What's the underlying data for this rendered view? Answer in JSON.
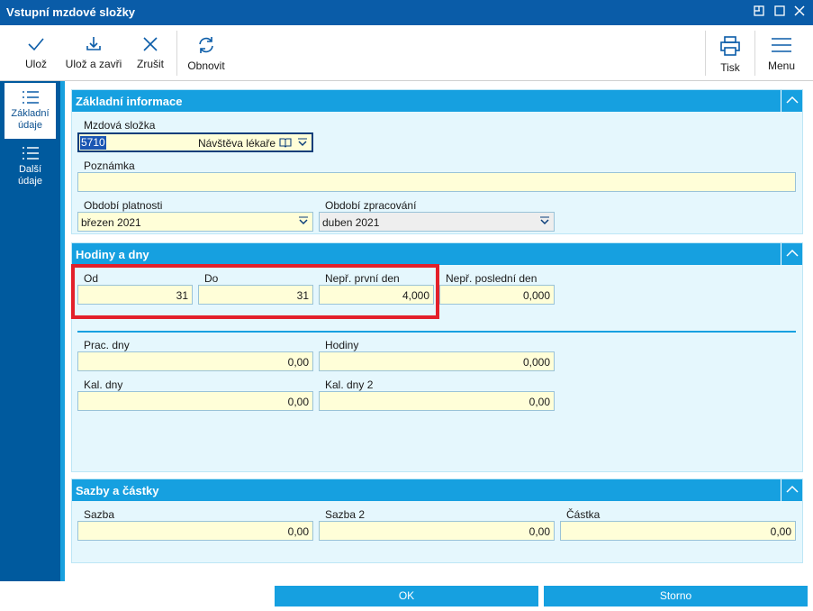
{
  "window": {
    "title": "Vstupní mzdové složky"
  },
  "toolbar": {
    "save": "Ulož",
    "save_close": "Ulož a zavři",
    "cancel": "Zrušit",
    "refresh": "Obnovit",
    "print": "Tisk",
    "menu": "Menu"
  },
  "nav": {
    "items": [
      {
        "label_line1": "Základní",
        "label_line2": "údaje",
        "active": true
      },
      {
        "label_line1": "Další",
        "label_line2": "údaje",
        "active": false
      }
    ]
  },
  "basic": {
    "title": "Základní informace",
    "component_label": "Mzdová složka",
    "component_code": "5710",
    "component_name": "Návštěva lékaře",
    "note_label": "Poznámka",
    "note_value": "",
    "validity_label": "Období platnosti",
    "validity_value": "březen 2021",
    "processing_label": "Období zpracování",
    "processing_value": "duben 2021"
  },
  "hours": {
    "title": "Hodiny a dny",
    "from_label": "Od",
    "from_value": "31",
    "to_label": "Do",
    "to_value": "31",
    "first_day_label": "Nepř. první den",
    "first_day_value": "4,000",
    "last_day_label": "Nepř. poslední den",
    "last_day_value": "0,000",
    "work_days_label": "Prac. dny",
    "work_days_value": "0,00",
    "hours_label": "Hodiny",
    "hours_value": "0,000",
    "cal_days_label": "Kal. dny",
    "cal_days_value": "0,00",
    "cal_days2_label": "Kal. dny 2",
    "cal_days2_value": "0,00"
  },
  "rates": {
    "title": "Sazby a částky",
    "rate_label": "Sazba",
    "rate_value": "0,00",
    "rate2_label": "Sazba 2",
    "rate2_value": "0,00",
    "amount_label": "Částka",
    "amount_value": "0,00"
  },
  "footer": {
    "ok": "OK",
    "storno": "Storno"
  },
  "colors": {
    "titlebar": "#0a5ca8",
    "section_header": "#16a0e0",
    "section_bg": "#e5f7fd",
    "input_bg": "#fffed8",
    "highlight": "#e3202a"
  }
}
